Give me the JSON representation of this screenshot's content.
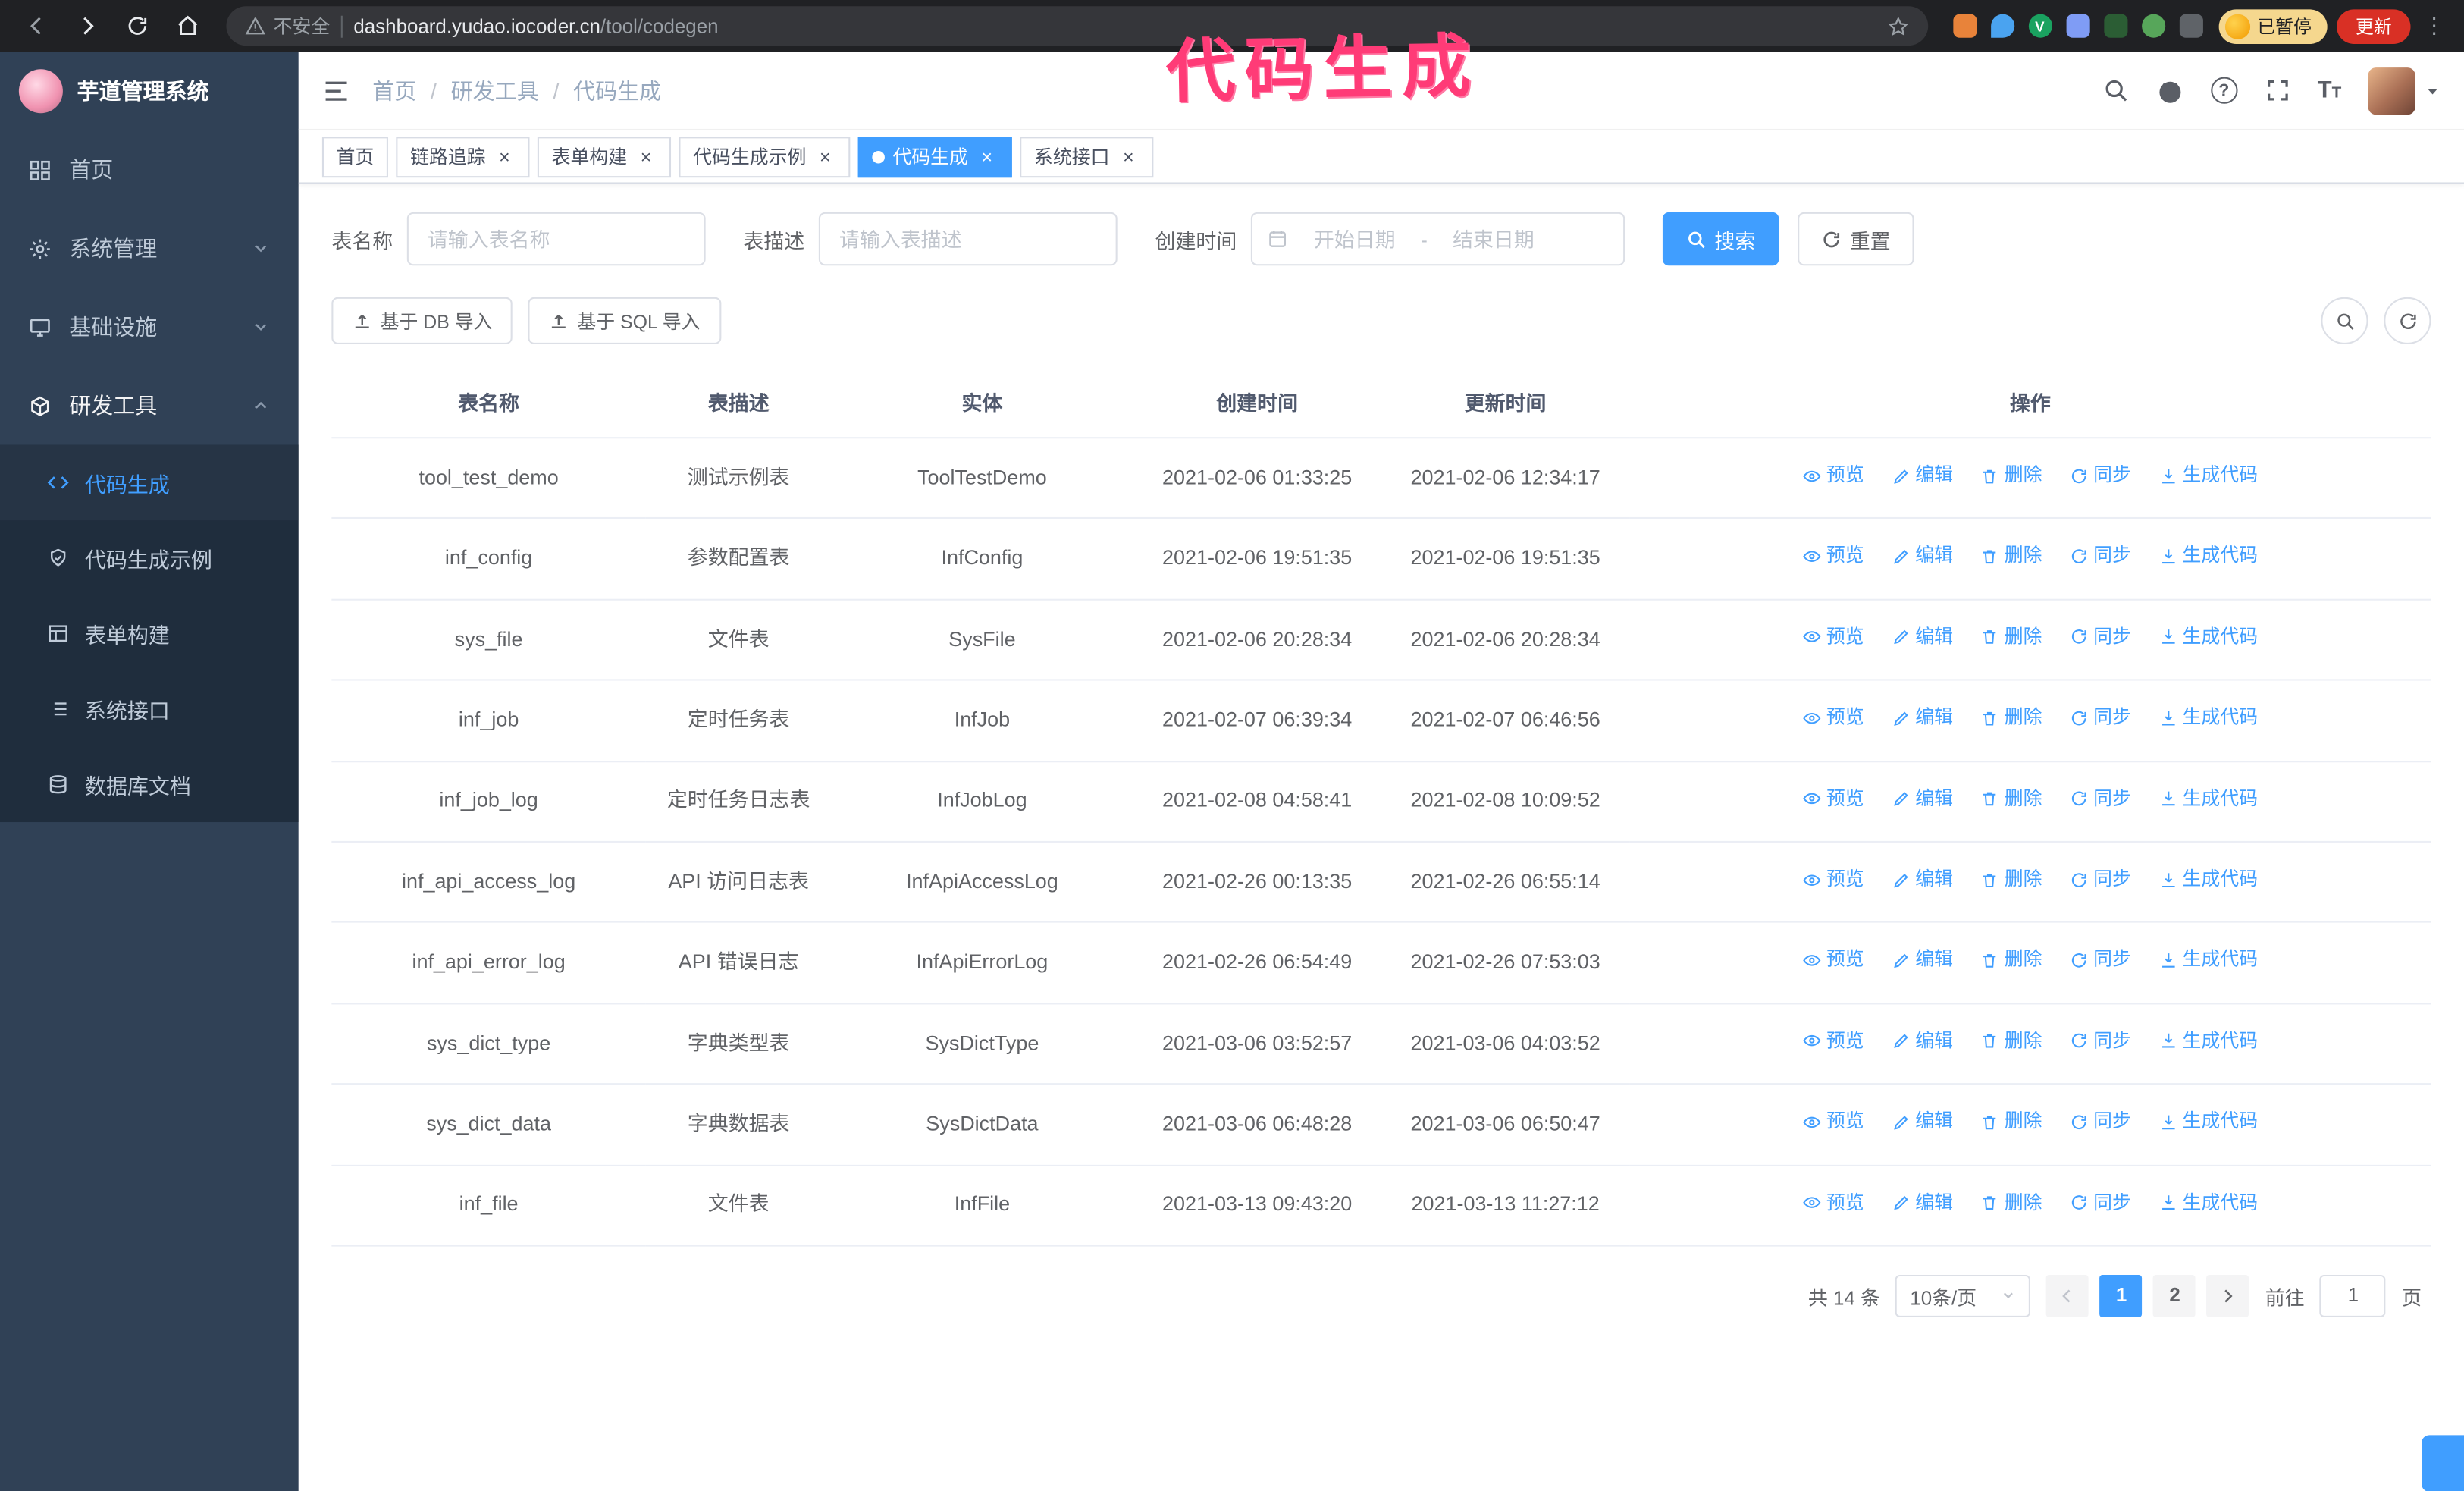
{
  "colors": {
    "accent": "#409eff",
    "sidebar_bg": "#304156",
    "annotation": "#ff3b77",
    "active_tab_bg": "#409eff"
  },
  "browser": {
    "security_label": "不安全",
    "url_host": "dashboard.yudao.iocoder.cn",
    "url_path": "/tool/codegen",
    "profile_status": "已暂停",
    "update_label": "更新",
    "extension_badge_v": "V"
  },
  "annotation": {
    "text": "代码生成"
  },
  "sidebar": {
    "title": "芋道管理系统",
    "items": [
      {
        "label": "首页"
      },
      {
        "label": "系统管理"
      },
      {
        "label": "基础设施"
      },
      {
        "label": "研发工具"
      }
    ],
    "sub_items": [
      {
        "label": "代码生成"
      },
      {
        "label": "代码生成示例"
      },
      {
        "label": "表单构建"
      },
      {
        "label": "系统接口"
      },
      {
        "label": "数据库文档"
      }
    ]
  },
  "breadcrumb": {
    "items": [
      "首页",
      "研发工具",
      "代码生成"
    ],
    "separator": "/"
  },
  "tabs": [
    {
      "label": "首页"
    },
    {
      "label": "链路追踪"
    },
    {
      "label": "表单构建"
    },
    {
      "label": "代码生成示例"
    },
    {
      "label": "代码生成"
    },
    {
      "label": "系统接口"
    }
  ],
  "filters": {
    "table_name_label": "表名称",
    "table_name_placeholder": "请输入表名称",
    "table_desc_label": "表描述",
    "table_desc_placeholder": "请输入表描述",
    "create_time_label": "创建时间",
    "date_start_placeholder": "开始日期",
    "date_separator": "-",
    "date_end_placeholder": "结束日期",
    "search_button": "搜索",
    "reset_button": "重置"
  },
  "toolbar": {
    "import_db_button": "基于 DB 导入",
    "import_sql_button": "基于 SQL 导入"
  },
  "table": {
    "columns": [
      "表名称",
      "表描述",
      "实体",
      "创建时间",
      "更新时间",
      "操作"
    ],
    "actions": [
      "预览",
      "编辑",
      "删除",
      "同步",
      "生成代码"
    ],
    "rows": [
      {
        "name": "tool_test_demo",
        "desc": "测试示例表",
        "entity": "ToolTestDemo",
        "created": "2021-02-06 01:33:25",
        "updated": "2021-02-06 12:34:17"
      },
      {
        "name": "inf_config",
        "desc": "参数配置表",
        "entity": "InfConfig",
        "created": "2021-02-06 19:51:35",
        "updated": "2021-02-06 19:51:35"
      },
      {
        "name": "sys_file",
        "desc": "文件表",
        "entity": "SysFile",
        "created": "2021-02-06 20:28:34",
        "updated": "2021-02-06 20:28:34"
      },
      {
        "name": "inf_job",
        "desc": "定时任务表",
        "entity": "InfJob",
        "created": "2021-02-07 06:39:34",
        "updated": "2021-02-07 06:46:56"
      },
      {
        "name": "inf_job_log",
        "desc": "定时任务日志表",
        "entity": "InfJobLog",
        "created": "2021-02-08 04:58:41",
        "updated": "2021-02-08 10:09:52"
      },
      {
        "name": "inf_api_access_log",
        "desc": "API 访问日志表",
        "entity": "InfApiAccessLog",
        "created": "2021-02-26 00:13:35",
        "updated": "2021-02-26 06:55:14"
      },
      {
        "name": "inf_api_error_log",
        "desc": "API 错误日志",
        "entity": "InfApiErrorLog",
        "created": "2021-02-26 06:54:49",
        "updated": "2021-02-26 07:53:03"
      },
      {
        "name": "sys_dict_type",
        "desc": "字典类型表",
        "entity": "SysDictType",
        "created": "2021-03-06 03:52:57",
        "updated": "2021-03-06 04:03:52"
      },
      {
        "name": "sys_dict_data",
        "desc": "字典数据表",
        "entity": "SysDictData",
        "created": "2021-03-06 06:48:28",
        "updated": "2021-03-06 06:50:47"
      },
      {
        "name": "inf_file",
        "desc": "文件表",
        "entity": "InfFile",
        "created": "2021-03-13 09:43:20",
        "updated": "2021-03-13 11:27:12"
      }
    ]
  },
  "pagination": {
    "total": "共 14 条",
    "page_size": "10条/页",
    "page1": "1",
    "page2": "2",
    "goto_label": "前往",
    "goto_value": "1",
    "unit_label": "页"
  },
  "icons": {
    "close": "×",
    "help": "?",
    "kebab": "⋮",
    "font_large": "T",
    "font_small": "T"
  }
}
